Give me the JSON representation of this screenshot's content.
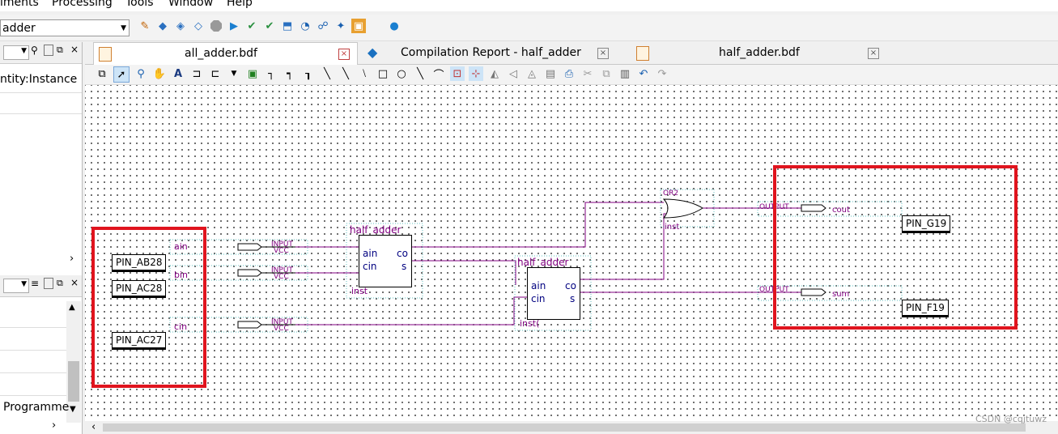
{
  "menu": {
    "items": [
      "iments",
      "Processing",
      "Tools",
      "Window",
      "Help"
    ]
  },
  "toolbar": {
    "entity_value": "adder"
  },
  "left_panel": {
    "top_row": "ntity:Instance",
    "bottom_row": "Programme"
  },
  "tabs": [
    {
      "label": "all_adder.bdf",
      "active": true
    },
    {
      "label": "Compilation Report - half_adder",
      "active": false
    },
    {
      "label": "half_adder.bdf",
      "active": false
    }
  ],
  "schematic": {
    "input_pins": [
      {
        "name": "ain",
        "type": "INPUT",
        "default": "VCC",
        "assignment": "PIN_AB28"
      },
      {
        "name": "bin",
        "type": "INPUT",
        "default": "VCC",
        "assignment": "PIN_AC28"
      },
      {
        "name": "cin",
        "type": "INPUT",
        "default": "VCC",
        "assignment": "PIN_AC27"
      }
    ],
    "output_pins": [
      {
        "name": "cout",
        "type": "OUTPUT",
        "assignment": "PIN_G19"
      },
      {
        "name": "sum",
        "type": "OUTPUT",
        "assignment": "PIN_F19"
      }
    ],
    "instances": [
      {
        "title": "half_adder",
        "ports_left": [
          "ain",
          "cin"
        ],
        "ports_right": [
          "co",
          "s"
        ],
        "name": "inst"
      },
      {
        "title": "half_adder",
        "ports_left": [
          "ain",
          "cin"
        ],
        "ports_right": [
          "co",
          "s"
        ],
        "name": "inst("
      }
    ],
    "or_gate": {
      "title": "OR2",
      "name": "inst"
    }
  },
  "watermark": "CSDN @cqjtuwz",
  "colors": {
    "highlight": "#e0141e",
    "wire": "#800080",
    "port_text": "#000080"
  }
}
